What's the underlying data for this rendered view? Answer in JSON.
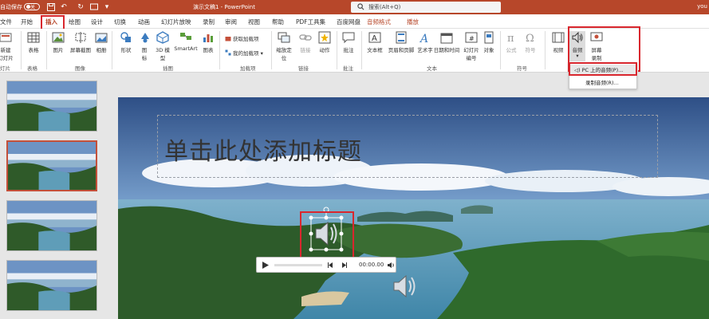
{
  "titlebar": {
    "autosave": "自动保存",
    "autosave_state": "关",
    "doc_title": "演示文稿1 - PowerPoint",
    "search_placeholder": "搜索(Alt+Q)",
    "user": "you"
  },
  "tabs": [
    "文件",
    "开始",
    "插入",
    "绘图",
    "设计",
    "切换",
    "动画",
    "幻灯片放映",
    "录制",
    "审阅",
    "视图",
    "帮助",
    "PDF工具集",
    "百度网盘",
    "音频格式",
    "播放"
  ],
  "ribbon": {
    "new_slide": "新建\n幻灯片",
    "table": "表格",
    "picture": "图片",
    "screenshot": "屏幕截图",
    "album": "相册",
    "shapes": "形状",
    "icons": "图\n标",
    "model3d": "3D 模\n型",
    "smartart": "SmartArt",
    "chart": "图表",
    "get_addins": "获取加载项",
    "my_addins": "我的加载项",
    "zoom": "缩放定\n位",
    "link": "链接",
    "action": "动作",
    "comment": "批注",
    "textbox": "文本框",
    "header_footer": "页眉和页脚",
    "wordart": "艺术字",
    "datetime": "日期和时间",
    "slide_number": "幻灯片\n编号",
    "object": "对象",
    "equation": "公式",
    "symbol": "符号",
    "video": "视频",
    "audio": "音频",
    "screen_record": "屏幕\n录制",
    "groups": {
      "slides": "灯片",
      "tables": "表格",
      "images": "图像",
      "illustrations": "插图",
      "addins": "加载项",
      "links": "链接",
      "comments": "批注",
      "text": "文本",
      "symbols": "符号"
    }
  },
  "dropdown": {
    "items": [
      "PC 上的音频(P)...",
      "录制音频(R)..."
    ]
  },
  "slide": {
    "title_placeholder": "单击此处添加标题",
    "player_time": "00:00.00"
  },
  "colors": {
    "accent": "#b7472a",
    "highlight": "#d9272e"
  }
}
